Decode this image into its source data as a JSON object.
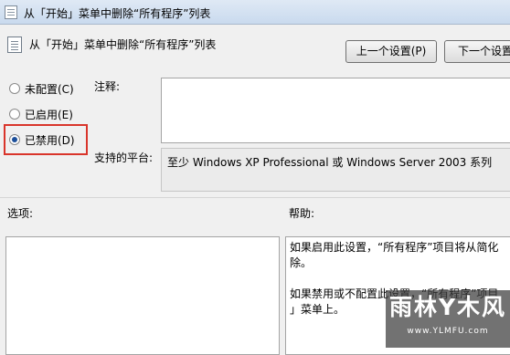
{
  "window": {
    "title": "从「开始」菜单中删除“所有程序”列表"
  },
  "header": {
    "policy_name": "从「开始」菜单中删除“所有程序”列表"
  },
  "buttons": {
    "prev": "上一个设置(P)",
    "next": "下一个设置"
  },
  "state": {
    "options": [
      {
        "label": "未配置(C)",
        "checked": false
      },
      {
        "label": "已启用(E)",
        "checked": false
      },
      {
        "label": "已禁用(D)",
        "checked": true
      }
    ]
  },
  "fields": {
    "comment_label": "注释:",
    "platform_label": "支持的平台:",
    "platform_value": "至少 Windows XP Professional 或 Windows Server 2003 系列"
  },
  "sections": {
    "options_label": "选项:",
    "help_label": "帮助:"
  },
  "help": {
    "para1": "如果启用此设置，“所有程序”项目将从简化\n除。",
    "para2": "如果禁用或不配置此设置，“所有程序”项目\n」菜单上。"
  },
  "watermark": {
    "main": "雨林Y木风",
    "sub": "www.YLMFU.com"
  },
  "colors": {
    "highlight": "#d9352b",
    "titlebar": "#c9daee"
  }
}
